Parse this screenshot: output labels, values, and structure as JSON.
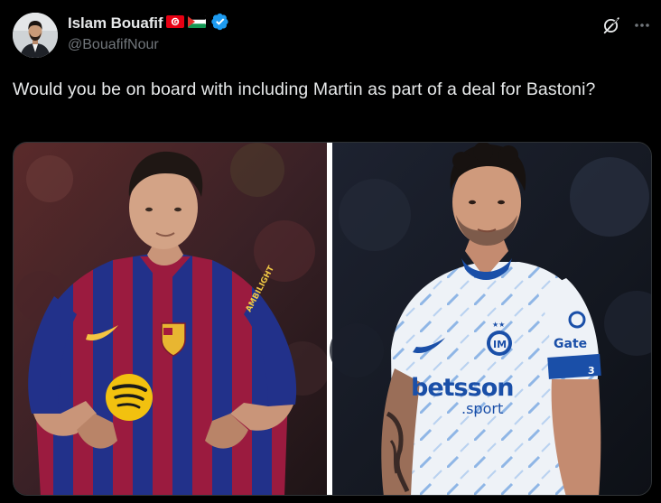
{
  "author": {
    "display_name": "Islam Bouafif",
    "handle": "@BouafifNour",
    "verified": true,
    "flags": [
      "tunisia-flag",
      "palestine-flag"
    ],
    "verified_color": "#1d9bf0"
  },
  "tweet": {
    "text": "Would you be on board with including Martin as part of a deal for Bastoni?"
  },
  "media": {
    "left_jersey_sponsor": "Spotify",
    "left_sleeve_text": "AMBILIGHT",
    "right_jersey_sponsor_main": "betsson",
    "right_jersey_sponsor_sub": ".sport",
    "right_sleeve_text": "Gate",
    "right_number": "3"
  },
  "icons": {
    "grok": "grok-icon",
    "more": "more-icon"
  },
  "colors": {
    "background": "#000000",
    "text_primary": "#e7e9ea",
    "text_secondary": "#71767b",
    "barca_blue": "#1f3a8f",
    "barca_red": "#a51a3c",
    "inter_white": "#eef2f7",
    "inter_blue": "#1a4fa8"
  }
}
